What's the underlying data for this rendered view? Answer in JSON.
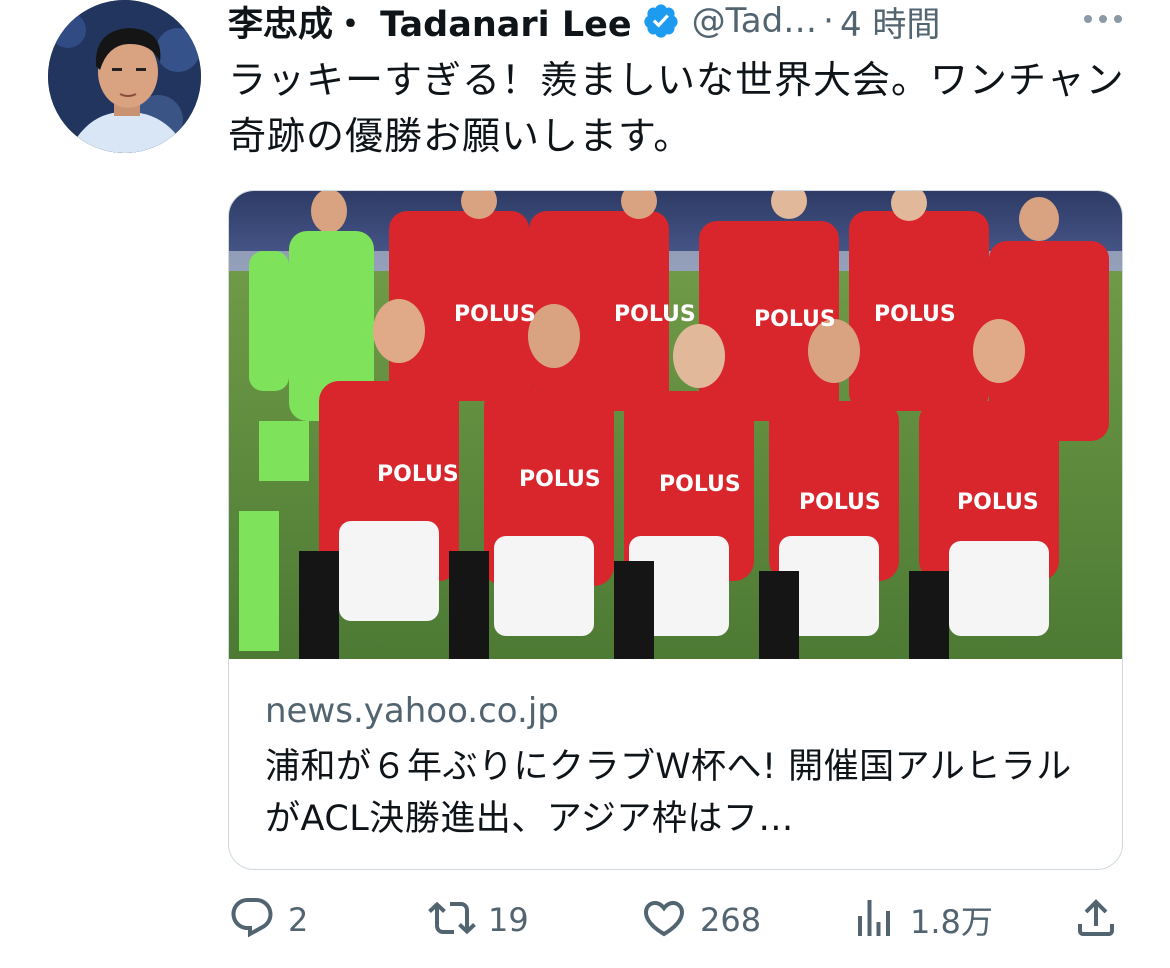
{
  "author": {
    "display_name": "李忠成・ Tadanari Lee",
    "handle": "@Tad…",
    "separator": "·",
    "time_ago": "4 時間",
    "verified": true
  },
  "tweet": {
    "text": "ラッキーすぎる！羨ましいな世界大会。ワンチャン奇跡の優勝お願いします。"
  },
  "link_card": {
    "domain": "news.yahoo.co.jp",
    "title": "浦和が６年ぶりにクラブＷ杯へ! 開催国アルヒラルがACL決勝進出、アジア枠はフ…",
    "image_alt": "team photo"
  },
  "actions": {
    "reply_count": "2",
    "retweet_count": "19",
    "like_count": "268",
    "view_count": "1.8万"
  },
  "colors": {
    "text_primary": "#0f1419",
    "text_secondary": "#536471",
    "verified_blue": "#1d9bf0",
    "card_border": "#cfd9de",
    "jersey_red": "#d8262c",
    "keeper_green": "#7ee25a",
    "pitch_green": "#5f8f3f"
  },
  "icons": [
    "verified-badge-icon",
    "more-icon",
    "reply-icon",
    "retweet-icon",
    "like-icon",
    "views-icon",
    "share-icon"
  ]
}
